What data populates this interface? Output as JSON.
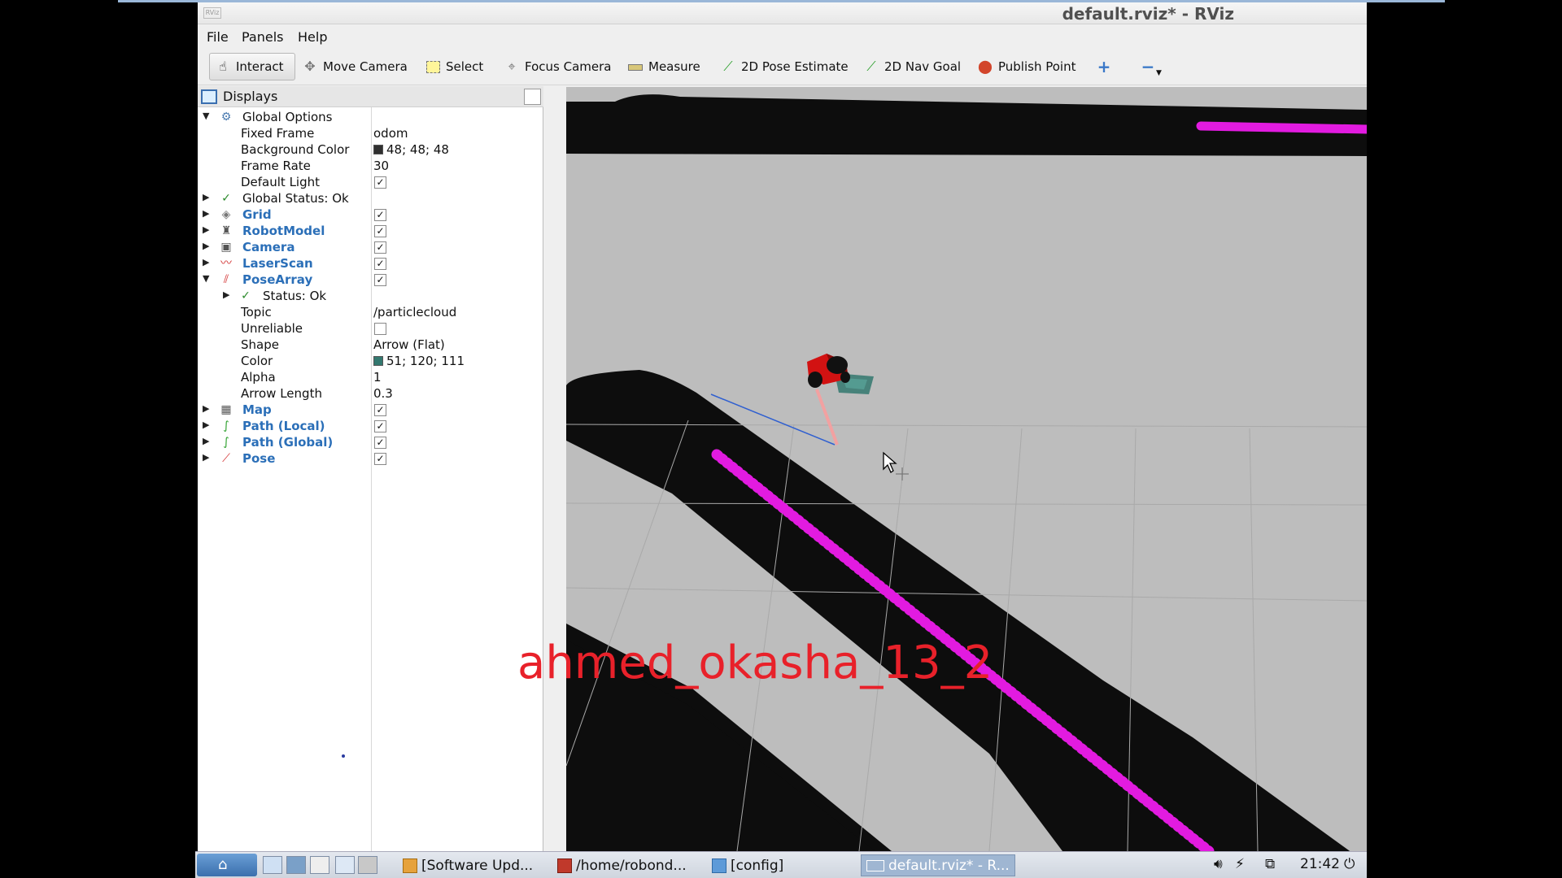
{
  "window": {
    "title": "default.rviz* - RViz"
  },
  "menu": {
    "file": "File",
    "panels": "Panels",
    "help": "Help"
  },
  "toolbar": {
    "interact": "Interact",
    "move_camera": "Move Camera",
    "select": "Select",
    "focus_camera": "Focus Camera",
    "measure": "Measure",
    "pose_estimate": "2D Pose Estimate",
    "nav_goal": "2D Nav Goal",
    "publish_point": "Publish Point"
  },
  "displays_panel": {
    "title": "Displays",
    "global_options": "Global Options",
    "fixed_frame_label": "Fixed Frame",
    "fixed_frame_value": "odom",
    "bg_color_label": "Background Color",
    "bg_color_value": "48; 48; 48",
    "frame_rate_label": "Frame Rate",
    "frame_rate_value": "30",
    "default_light_label": "Default Light",
    "global_status": "Global Status: Ok",
    "grid": "Grid",
    "robot_model": "RobotModel",
    "camera": "Camera",
    "laser_scan": "LaserScan",
    "pose_array": "PoseArray",
    "status_ok": "Status: Ok",
    "topic_label": "Topic",
    "topic_value": "/particlecloud",
    "unreliable_label": "Unreliable",
    "shape_label": "Shape",
    "shape_value": "Arrow (Flat)",
    "color_label": "Color",
    "color_value": "51; 120; 111",
    "alpha_label": "Alpha",
    "alpha_value": "1",
    "arrow_length_label": "Arrow Length",
    "arrow_length_value": "0.3",
    "map": "Map",
    "path_local": "Path (Local)",
    "path_global": "Path (Global)",
    "pose": "Pose"
  },
  "colors": {
    "background_swatch": "#303030",
    "particle_swatch": "#33786f",
    "path": "#e21be0",
    "accent": "#2b6fb8"
  },
  "watermark": "ahmed_okasha_13_2",
  "taskbar": {
    "task1": "[Software Upd...",
    "task2": "/home/robond...",
    "task3": "[config]",
    "task4": "default.rviz* - R...",
    "clock": "21:42"
  }
}
